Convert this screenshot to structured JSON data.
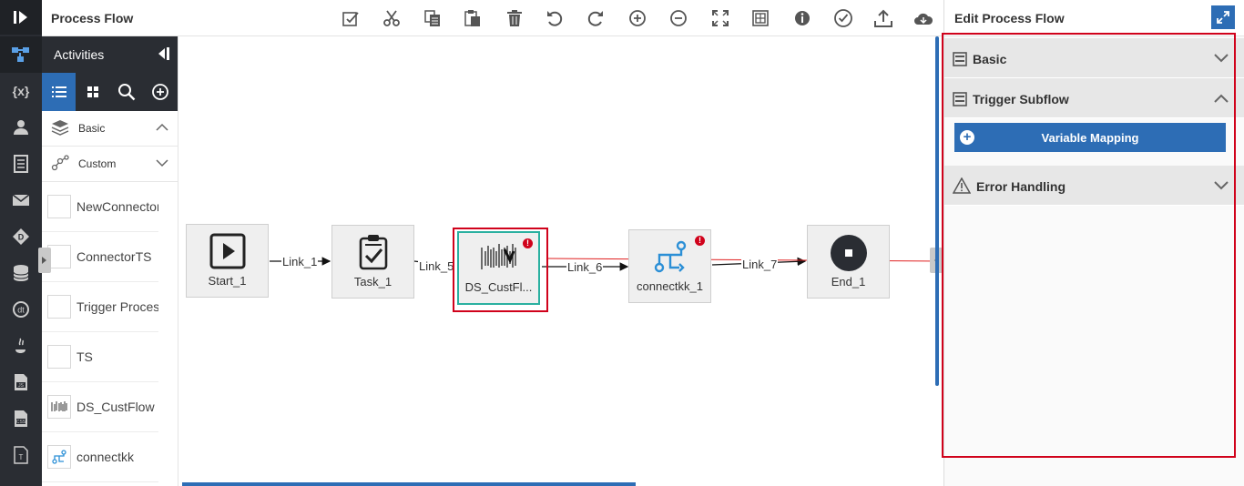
{
  "header": {
    "title": "Process Flow"
  },
  "activities": {
    "title": "Activities",
    "groups": [
      {
        "label": "Basic",
        "icon": "layers-icon"
      },
      {
        "label": "Custom",
        "icon": "nodes-icon"
      }
    ],
    "items": [
      {
        "label": "NewConnector"
      },
      {
        "label": "ConnectorTS"
      },
      {
        "label": "Trigger Process"
      },
      {
        "label": "TS"
      },
      {
        "label": "DS_CustFlow"
      },
      {
        "label": "connectkk"
      }
    ]
  },
  "toolbar": {
    "icons": [
      "validate-icon",
      "cut-icon",
      "copy-icon",
      "paste-icon",
      "delete-icon",
      "undo-icon",
      "redo-icon",
      "zoom-in-icon",
      "zoom-out-icon",
      "fit-screen-icon",
      "grid-icon",
      "info-icon",
      "check-icon",
      "upload-icon",
      "cloud-icon"
    ]
  },
  "flow": {
    "nodes": [
      {
        "label": "Start_1",
        "icon": "play-icon",
        "error": false
      },
      {
        "label": "Task_1",
        "icon": "clipboard-check-icon",
        "error": false
      },
      {
        "label": "DS_CustFl...",
        "icon": "subflow-thumbnail-icon",
        "error": true
      },
      {
        "label": "connectkk_1",
        "icon": "connector-icon",
        "error": true
      },
      {
        "label": "End_1",
        "icon": "stop-icon",
        "error": false
      }
    ],
    "links": [
      {
        "label": "Link_1"
      },
      {
        "label": "Link_5"
      },
      {
        "label": "Link_6"
      },
      {
        "label": "Link_7"
      }
    ]
  },
  "right_panel": {
    "title": "Edit Process Flow",
    "sections": [
      {
        "label": "Basic",
        "expanded": false
      },
      {
        "label": "Trigger Subflow",
        "expanded": true
      },
      {
        "label": "Error Handling",
        "expanded": false
      }
    ],
    "variable_mapping_label": "Variable Mapping"
  },
  "colors": {
    "accent": "#2d6db5",
    "nav_bg": "#2a2d33",
    "highlight": "#d0021b",
    "selected_node_border": "#2ab0a0"
  }
}
